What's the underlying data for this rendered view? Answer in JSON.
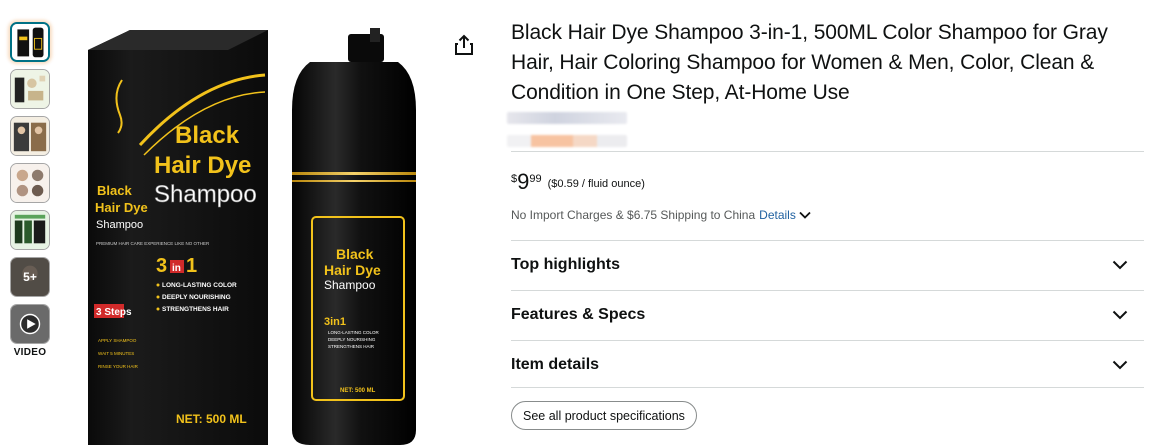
{
  "gallery": {
    "thumbnails": [
      {
        "name": "thumb-main-product",
        "selected": true
      },
      {
        "name": "thumb-box-front",
        "selected": false
      },
      {
        "name": "thumb-before-after",
        "selected": false
      },
      {
        "name": "thumb-usage-steps",
        "selected": false
      },
      {
        "name": "thumb-features",
        "selected": false
      }
    ],
    "more_label": "5+",
    "video_label": "VIDEO"
  },
  "main_image": {
    "box": {
      "brand_line1": "Black",
      "brand_line2": "Hair Dye",
      "brand_line3": "Shampoo",
      "side_line1": "Black",
      "side_line2": "Hair Dye",
      "side_line3": "Shampoo",
      "side_small": "PREMIUM HAIR CARE EXPERIENCE LIKE NO OTHER",
      "three_in": "3",
      "in": "in",
      "one": "1",
      "bullets": [
        "LONG-LASTING COLOR",
        "DEEPLY NOURISHING",
        "STRENGTHENS HAIR"
      ],
      "steps_label": "3 Steps",
      "steps": [
        "APPLY SHAMPOO",
        "WAIT 5 MINUTES",
        "RINSE YOUR HAIR"
      ],
      "net": "NET: 500 ML"
    },
    "bottle": {
      "line1": "Black",
      "line2": "Hair Dye",
      "line3": "Shampoo",
      "three_in_one": "3in1",
      "bullets": [
        "LONG-LASTING COLOR",
        "DEEPLY NOURISHING",
        "STRENGTHENS HAIR"
      ],
      "net": "NET: 500 ML"
    }
  },
  "product": {
    "title": "Black Hair Dye Shampoo 3-in-1, 500ML Color Shampoo for Gray Hair, Hair Coloring Shampoo for Women & Men, Color, Clean & Condition in One Step, At-Home Use",
    "price_symbol": "$",
    "price_whole": "9",
    "price_fraction": "99",
    "unit_price": "($0.59 / fluid ounce)",
    "shipping_text": "No Import Charges & $6.75 Shipping to China",
    "details_link": "Details"
  },
  "sections": [
    {
      "label": "Top highlights"
    },
    {
      "label": "Features & Specs"
    },
    {
      "label": "Item details"
    }
  ],
  "specs_button": "See all product specifications",
  "colors": {
    "accent_link": "#2162a1",
    "selected_thumb_border": "#007185",
    "gold": "#f2c21b",
    "divider": "#d5d9d9"
  }
}
